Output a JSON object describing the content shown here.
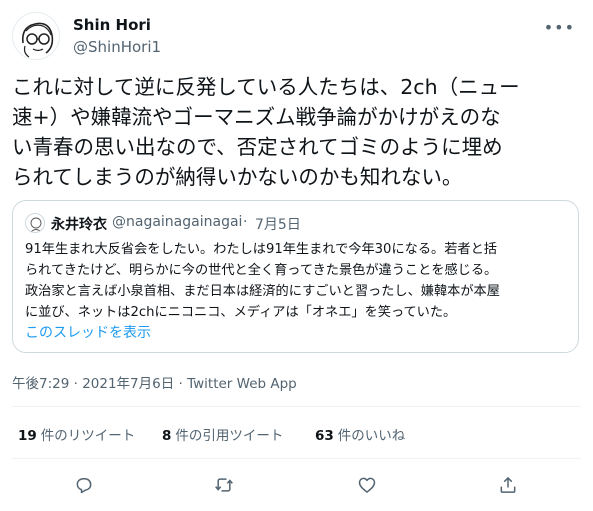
{
  "author": {
    "name": "Shin Hori",
    "handle": "@ShinHori1"
  },
  "tweet": {
    "text": "これに対して逆に反発している人たちは、2ch（ニュー\n速+）や嫌韓流やゴーマニズム戦争論がかけがえのな\nい青春の思い出なので、否定されてゴミのように埋め\nられてしまうのが納得いかないのかも知れない。"
  },
  "quote": {
    "name": "永井玲衣",
    "handle": "@nagainagainagai",
    "separator": "·",
    "date": "7月5日",
    "text": "91年生まれ大反省会をしたい。わたしは91年生まれで今年30になる。若者と括\nられてきたけど、明らかに今の世代と全く育ってきた景色が違うことを感じる。\n政治家と言えば小泉首相、まだ日本は経済的にすごいと習ったし、嫌韓本が本屋\nに並び、ネットは2chにニコニコ、メディアは「オネエ」を笑っていた。",
    "thread_link": "このスレッドを表示"
  },
  "meta": {
    "timestamp": "午後7:29 · 2021年7月6日 · Twitter Web App"
  },
  "stats": {
    "retweets_count": "19",
    "retweets_label": "件のリツイート",
    "quotes_count": "8",
    "quotes_label": "件の引用ツイート",
    "likes_count": "63",
    "likes_label": "件のいいね"
  },
  "icons": {
    "more": "more-icon",
    "reply": "reply-icon",
    "retweet": "retweet-icon",
    "like": "like-icon",
    "share": "share-icon"
  },
  "colors": {
    "link": "#1d9bf0",
    "secondary_text": "#536471",
    "primary_text": "#0f1419",
    "border": "#cfd9de"
  }
}
